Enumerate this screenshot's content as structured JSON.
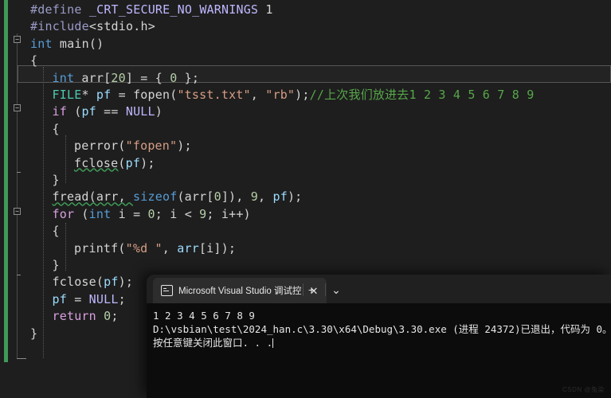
{
  "editor": {
    "lines": [
      {
        "indent": 0,
        "tokens": [
          {
            "t": "#define ",
            "c": "pp"
          },
          {
            "t": "_CRT_SECURE_NO_WARNINGS",
            "c": "mac"
          },
          {
            "t": " 1",
            "c": "pl"
          }
        ]
      },
      {
        "indent": 0,
        "tokens": [
          {
            "t": "#include",
            "c": "pp"
          },
          {
            "t": "<stdio.h>",
            "c": "pl"
          }
        ]
      },
      {
        "indent": 0,
        "tokens": [
          {
            "t": "int",
            "c": "kw"
          },
          {
            "t": " main()",
            "c": "pl"
          }
        ]
      },
      {
        "indent": 0,
        "tokens": [
          {
            "t": "{",
            "c": "pl"
          }
        ]
      },
      {
        "indent": 1,
        "tokens": [
          {
            "t": "int",
            "c": "kw"
          },
          {
            "t": " arr[",
            "c": "pl"
          },
          {
            "t": "20",
            "c": "num"
          },
          {
            "t": "] = { ",
            "c": "pl"
          },
          {
            "t": "0",
            "c": "num"
          },
          {
            "t": " };",
            "c": "pl"
          }
        ]
      },
      {
        "indent": 1,
        "tokens": [
          {
            "t": "FILE",
            "c": "typ"
          },
          {
            "t": "* ",
            "c": "pl"
          },
          {
            "t": "pf",
            "c": "var"
          },
          {
            "t": " = fopen(",
            "c": "pl"
          },
          {
            "t": "\"tsst.txt\"",
            "c": "str"
          },
          {
            "t": ", ",
            "c": "pl"
          },
          {
            "t": "\"rb\"",
            "c": "str"
          },
          {
            "t": ");",
            "c": "pl"
          },
          {
            "t": "//上次我们放进去1 2 3 4 5 6 7 8 9",
            "c": "cmt"
          }
        ]
      },
      {
        "indent": 1,
        "tokens": [
          {
            "t": "if",
            "c": "kwc"
          },
          {
            "t": " (",
            "c": "pl"
          },
          {
            "t": "pf",
            "c": "var"
          },
          {
            "t": " == ",
            "c": "pl"
          },
          {
            "t": "NULL",
            "c": "mac"
          },
          {
            "t": ")",
            "c": "pl"
          }
        ]
      },
      {
        "indent": 1,
        "tokens": [
          {
            "t": "{",
            "c": "pl"
          }
        ]
      },
      {
        "indent": 2,
        "tokens": [
          {
            "t": "perror(",
            "c": "pl"
          },
          {
            "t": "\"fopen\"",
            "c": "str"
          },
          {
            "t": ");",
            "c": "pl"
          }
        ]
      },
      {
        "indent": 2,
        "tokens": [
          {
            "t": "fclose",
            "c": "sq"
          },
          {
            "t": "(",
            "c": "pl"
          },
          {
            "t": "pf",
            "c": "var"
          },
          {
            "t": ");",
            "c": "pl"
          }
        ]
      },
      {
        "indent": 1,
        "tokens": [
          {
            "t": "}",
            "c": "pl"
          }
        ]
      },
      {
        "indent": 1,
        "tokens": [
          {
            "t": "fread(arr, ",
            "c": "sq"
          },
          {
            "t": "sizeof",
            "c": "kw"
          },
          {
            "t": "(arr[",
            "c": "pl"
          },
          {
            "t": "0",
            "c": "num"
          },
          {
            "t": "]), ",
            "c": "pl"
          },
          {
            "t": "9",
            "c": "num"
          },
          {
            "t": ", ",
            "c": "pl"
          },
          {
            "t": "pf",
            "c": "var"
          },
          {
            "t": ");",
            "c": "pl"
          }
        ]
      },
      {
        "indent": 1,
        "tokens": [
          {
            "t": "for",
            "c": "kwc"
          },
          {
            "t": " (",
            "c": "pl"
          },
          {
            "t": "int",
            "c": "kw"
          },
          {
            "t": " i = ",
            "c": "pl"
          },
          {
            "t": "0",
            "c": "num"
          },
          {
            "t": "; i < ",
            "c": "pl"
          },
          {
            "t": "9",
            "c": "num"
          },
          {
            "t": "; i++)",
            "c": "pl"
          }
        ]
      },
      {
        "indent": 1,
        "tokens": [
          {
            "t": "{",
            "c": "pl"
          }
        ]
      },
      {
        "indent": 2,
        "tokens": [
          {
            "t": "printf(",
            "c": "pl"
          },
          {
            "t": "\"%d \"",
            "c": "str"
          },
          {
            "t": ", ",
            "c": "pl"
          },
          {
            "t": "arr",
            "c": "var"
          },
          {
            "t": "[i]);",
            "c": "pl"
          }
        ]
      },
      {
        "indent": 1,
        "tokens": [
          {
            "t": "}",
            "c": "pl"
          }
        ]
      },
      {
        "indent": 1,
        "tokens": [
          {
            "t": "fclose(",
            "c": "pl"
          },
          {
            "t": "pf",
            "c": "var"
          },
          {
            "t": ");",
            "c": "pl"
          }
        ]
      },
      {
        "indent": 1,
        "tokens": [
          {
            "t": "pf",
            "c": "var"
          },
          {
            "t": " = ",
            "c": "pl"
          },
          {
            "t": "NULL",
            "c": "mac"
          },
          {
            "t": ";",
            "c": "pl"
          }
        ]
      },
      {
        "indent": 1,
        "tokens": [
          {
            "t": "return",
            "c": "kwc"
          },
          {
            "t": " ",
            "c": "pl"
          },
          {
            "t": "0",
            "c": "num"
          },
          {
            "t": ";",
            "c": "pl"
          }
        ]
      },
      {
        "indent": 0,
        "tokens": [
          {
            "t": "}",
            "c": "pl"
          }
        ]
      }
    ],
    "gutter": {
      "collapse_markers": [
        "-",
        "-",
        "-"
      ],
      "change_bar_color": "#3f9a57"
    },
    "colors": {
      "background": "#1e1e1e",
      "default_text": "#d4d4d4",
      "keyword": "#569cd6",
      "control_keyword": "#d8a0df",
      "type": "#4ec9b0",
      "variable": "#9cdcfe",
      "number": "#b5cea8",
      "string": "#d69d85",
      "comment": "#57a64a",
      "macro": "#beb7ff",
      "preprocessor": "#9b9bc9"
    }
  },
  "console": {
    "tab": {
      "title": "Microsoft Visual Studio 调试控",
      "icon": "console-icon",
      "close_label": "✕"
    },
    "new_tab_label": "+",
    "dropdown_label": "⌄",
    "output_lines": [
      "1 2 3 4 5 6 7 8 9",
      "D:\\vsbian\\test\\2024_han.c\\3.30\\x64\\Debug\\3.30.exe (进程 24372)已退出，代码为 0。",
      "按任意键关闭此窗口. . ."
    ],
    "background": "#0c0c0c",
    "titlebar_background": "#202020"
  },
  "watermark": {
    "text": "CSDN @兔染"
  }
}
